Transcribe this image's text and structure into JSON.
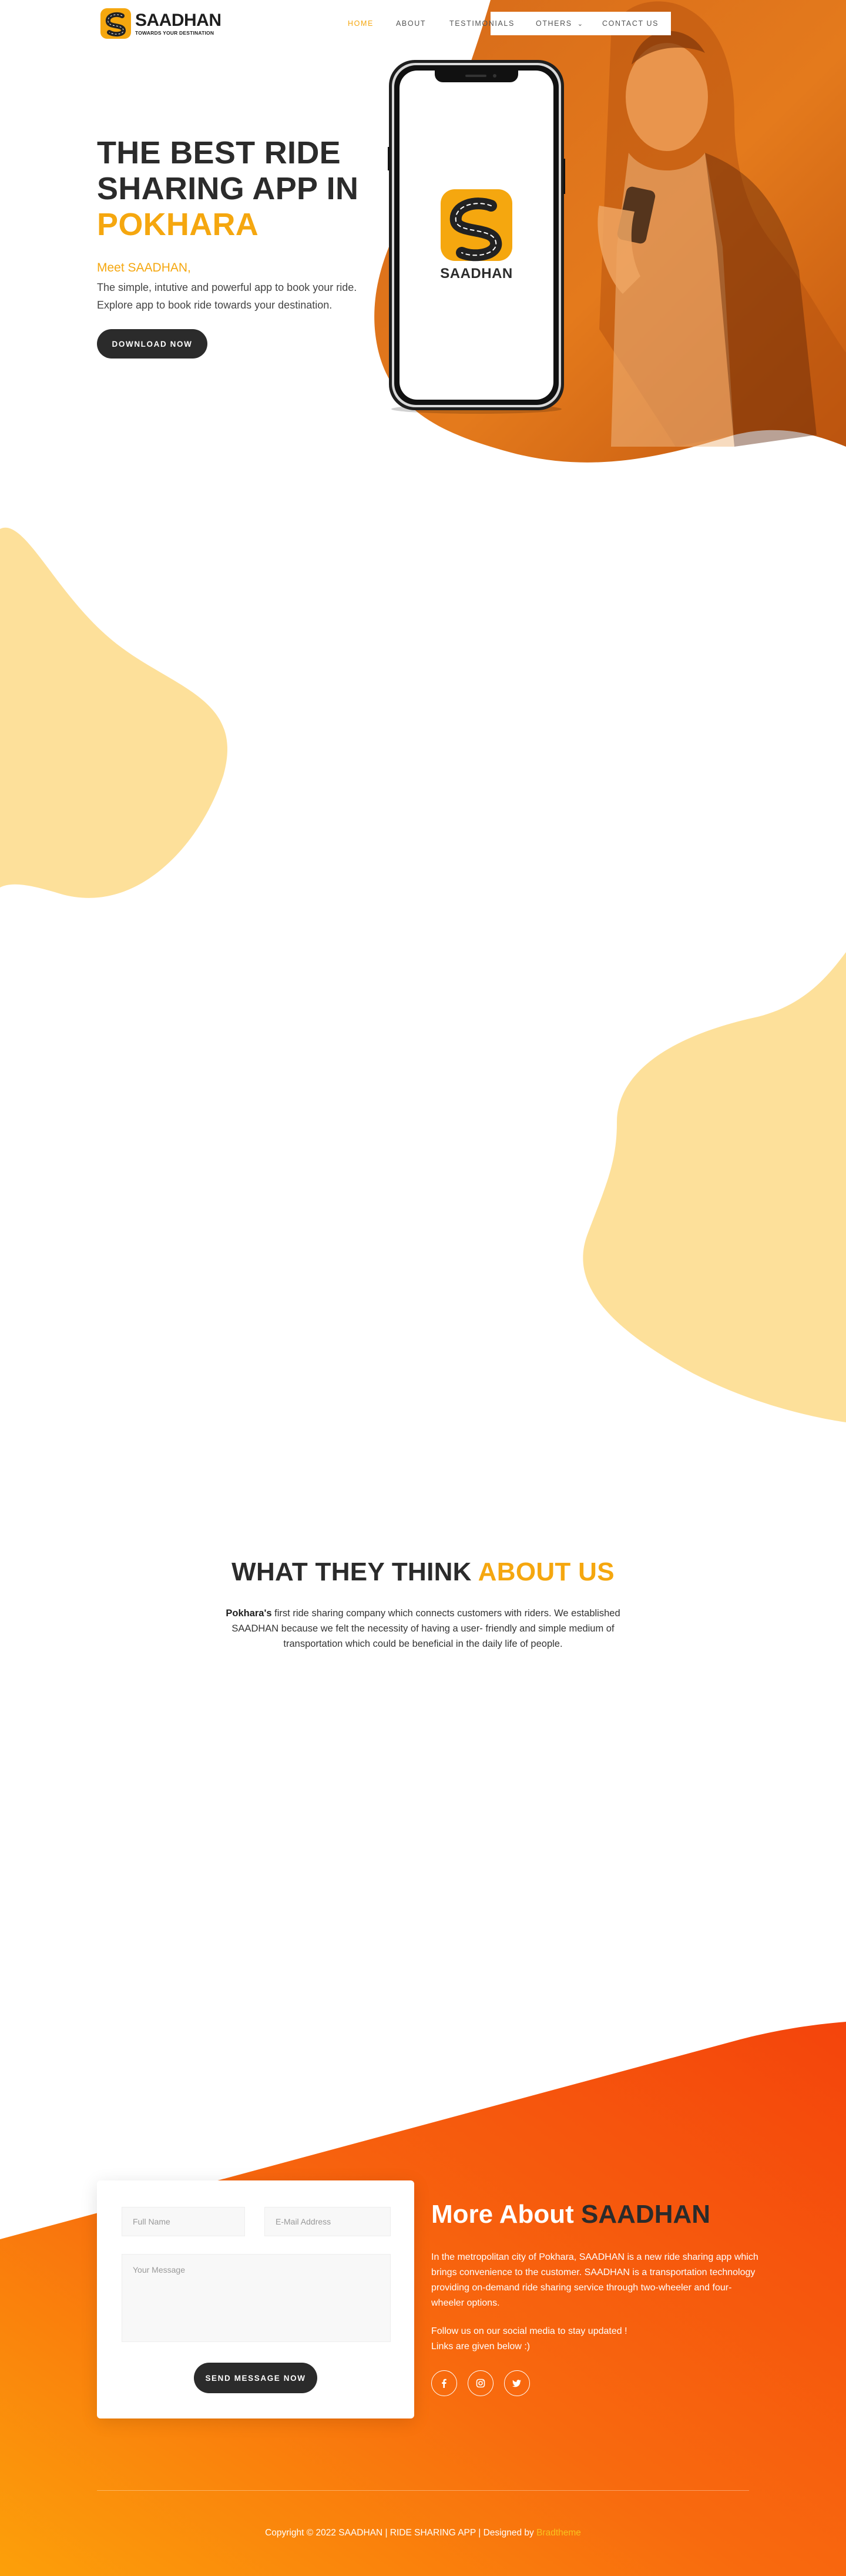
{
  "brand": {
    "name": "SAADHAN",
    "tagline": "TOWARDS YOUR DESTINATION",
    "accent_color": "#f5a70f",
    "dark_color": "#2b2b2b"
  },
  "nav": {
    "items": [
      {
        "label": "HOME",
        "active": true
      },
      {
        "label": "ABOUT",
        "active": false
      },
      {
        "label": "TESTIMONIALS",
        "active": false
      },
      {
        "label": "OTHERS",
        "active": false
      },
      {
        "label": "CONTACT US",
        "active": false
      }
    ],
    "others_caret": "⌄"
  },
  "hero": {
    "title_line1": "THE BEST RIDE",
    "title_line2": "SHARING APP IN",
    "title_accent": "POKHARA",
    "meet": "Meet SAADHAN,",
    "desc_line1": "The simple, intutive and powerful app to book your ride.",
    "desc_line2": "Explore app to book ride towards your destination.",
    "button": "DOWNLOAD NOW",
    "phone_app_name": "SAADHAN"
  },
  "testimonials": {
    "title": "WHAT THEY THINK",
    "title_accent": "ABOUT US",
    "desc_bold": "Pokhara's",
    "desc_rest": " first ride sharing company which connects customers with riders. We established SAADHAN because we felt the necessity of having a user- friendly and simple medium of transportation which could be beneficial in the daily life of people."
  },
  "contact": {
    "name_placeholder": "Full Name",
    "email_placeholder": "E-Mail Address",
    "message_placeholder": "Your Message",
    "button": "SEND MESSAGE NOW"
  },
  "about": {
    "title": "More About",
    "title_accent": "SAADHAN",
    "desc": "In the metropolitan city of Pokhara, SAADHAN is a new ride sharing app which brings convenience to the customer. SAADHAN is a transportation technology providing on-demand ride sharing service through two-wheeler and four-wheeler options.",
    "follow_line1": "Follow us on our social media to stay updated !",
    "follow_line2": "Links are given below :)",
    "socials": [
      {
        "icon": "facebook-icon"
      },
      {
        "icon": "instagram-icon"
      },
      {
        "icon": "twitter-icon"
      }
    ]
  },
  "footer": {
    "copyright": "Copyright © 2022 SAADHAN | RIDE SHARING APP | Designed by",
    "designer": "Bradtheme"
  }
}
